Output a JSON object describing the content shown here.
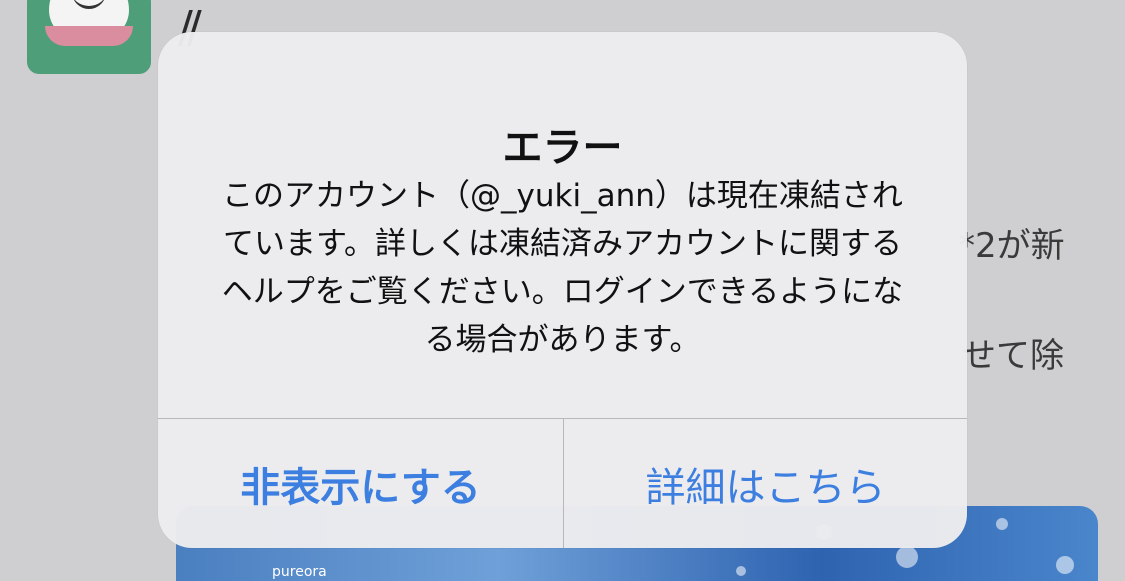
{
  "background": {
    "feed_text_line1": "*2が新",
    "feed_text_line2": "せて除",
    "ad_brand": "pureora",
    "slash_mark": "//"
  },
  "alert": {
    "title": "エラー",
    "message": "このアカウント（@_yuki_ann）は現在凍結されています。詳しくは凍結済みアカウントに関するヘルプをご覧ください。ログインできるようになる場合があります。",
    "hide_button_label": "非表示にする",
    "details_button_label": "詳細はこちら"
  },
  "colors": {
    "button_text": "#3d7fe0",
    "dialog_background": "#ececee",
    "avatar_background": "#4f9e7a"
  }
}
